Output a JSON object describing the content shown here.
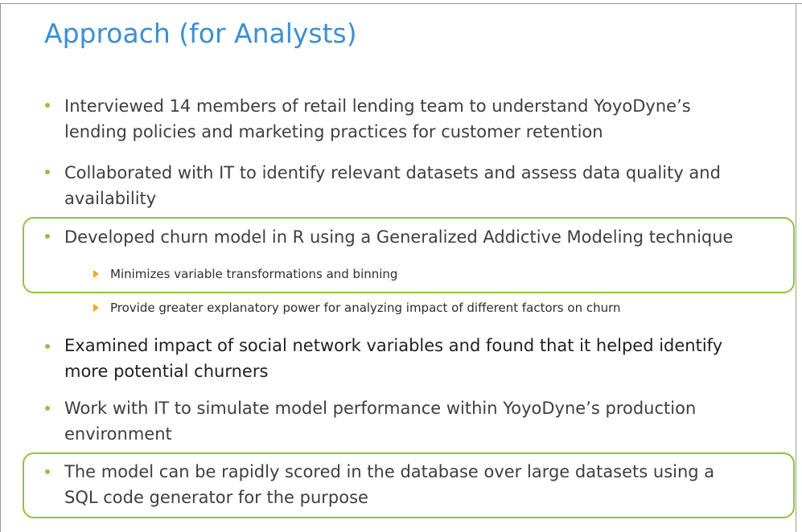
{
  "slide": {
    "title": "Approach (for Analysts)",
    "bullets": [
      {
        "line1": "Interviewed 14 members of retail lending team to understand YoyoDyne’s",
        "line2": "lending policies and marketing practices for customer retention"
      },
      {
        "line1": "Collaborated with IT to identify relevant datasets and assess data quality and",
        "line2": "availability"
      },
      {
        "line1": "Developed churn model in R using a Generalized Addictive Modeling technique",
        "subs": [
          "Minimizes variable transformations and binning",
          "Provide greater explanatory power for analyzing impact of different factors on churn"
        ]
      },
      {
        "line1": "Examined impact of social network variables and found that it helped identify",
        "line2": "more potential churners"
      },
      {
        "line1": "Work with IT to simulate model performance within YoyoDyne’s production",
        "line2": "environment"
      },
      {
        "line1": "The model can be rapidly scored in the database over large datasets using a",
        "line2": "SQL code generator for the purpose"
      }
    ]
  },
  "colors": {
    "title": "#3b8fd4",
    "bullet_dot": "#8cc63f",
    "sub_arrow": "#f5a623",
    "highlight_border": "#8cc63f"
  },
  "icons": {
    "bullet": "green-dot-icon",
    "sub_bullet": "orange-triangle-icon"
  }
}
